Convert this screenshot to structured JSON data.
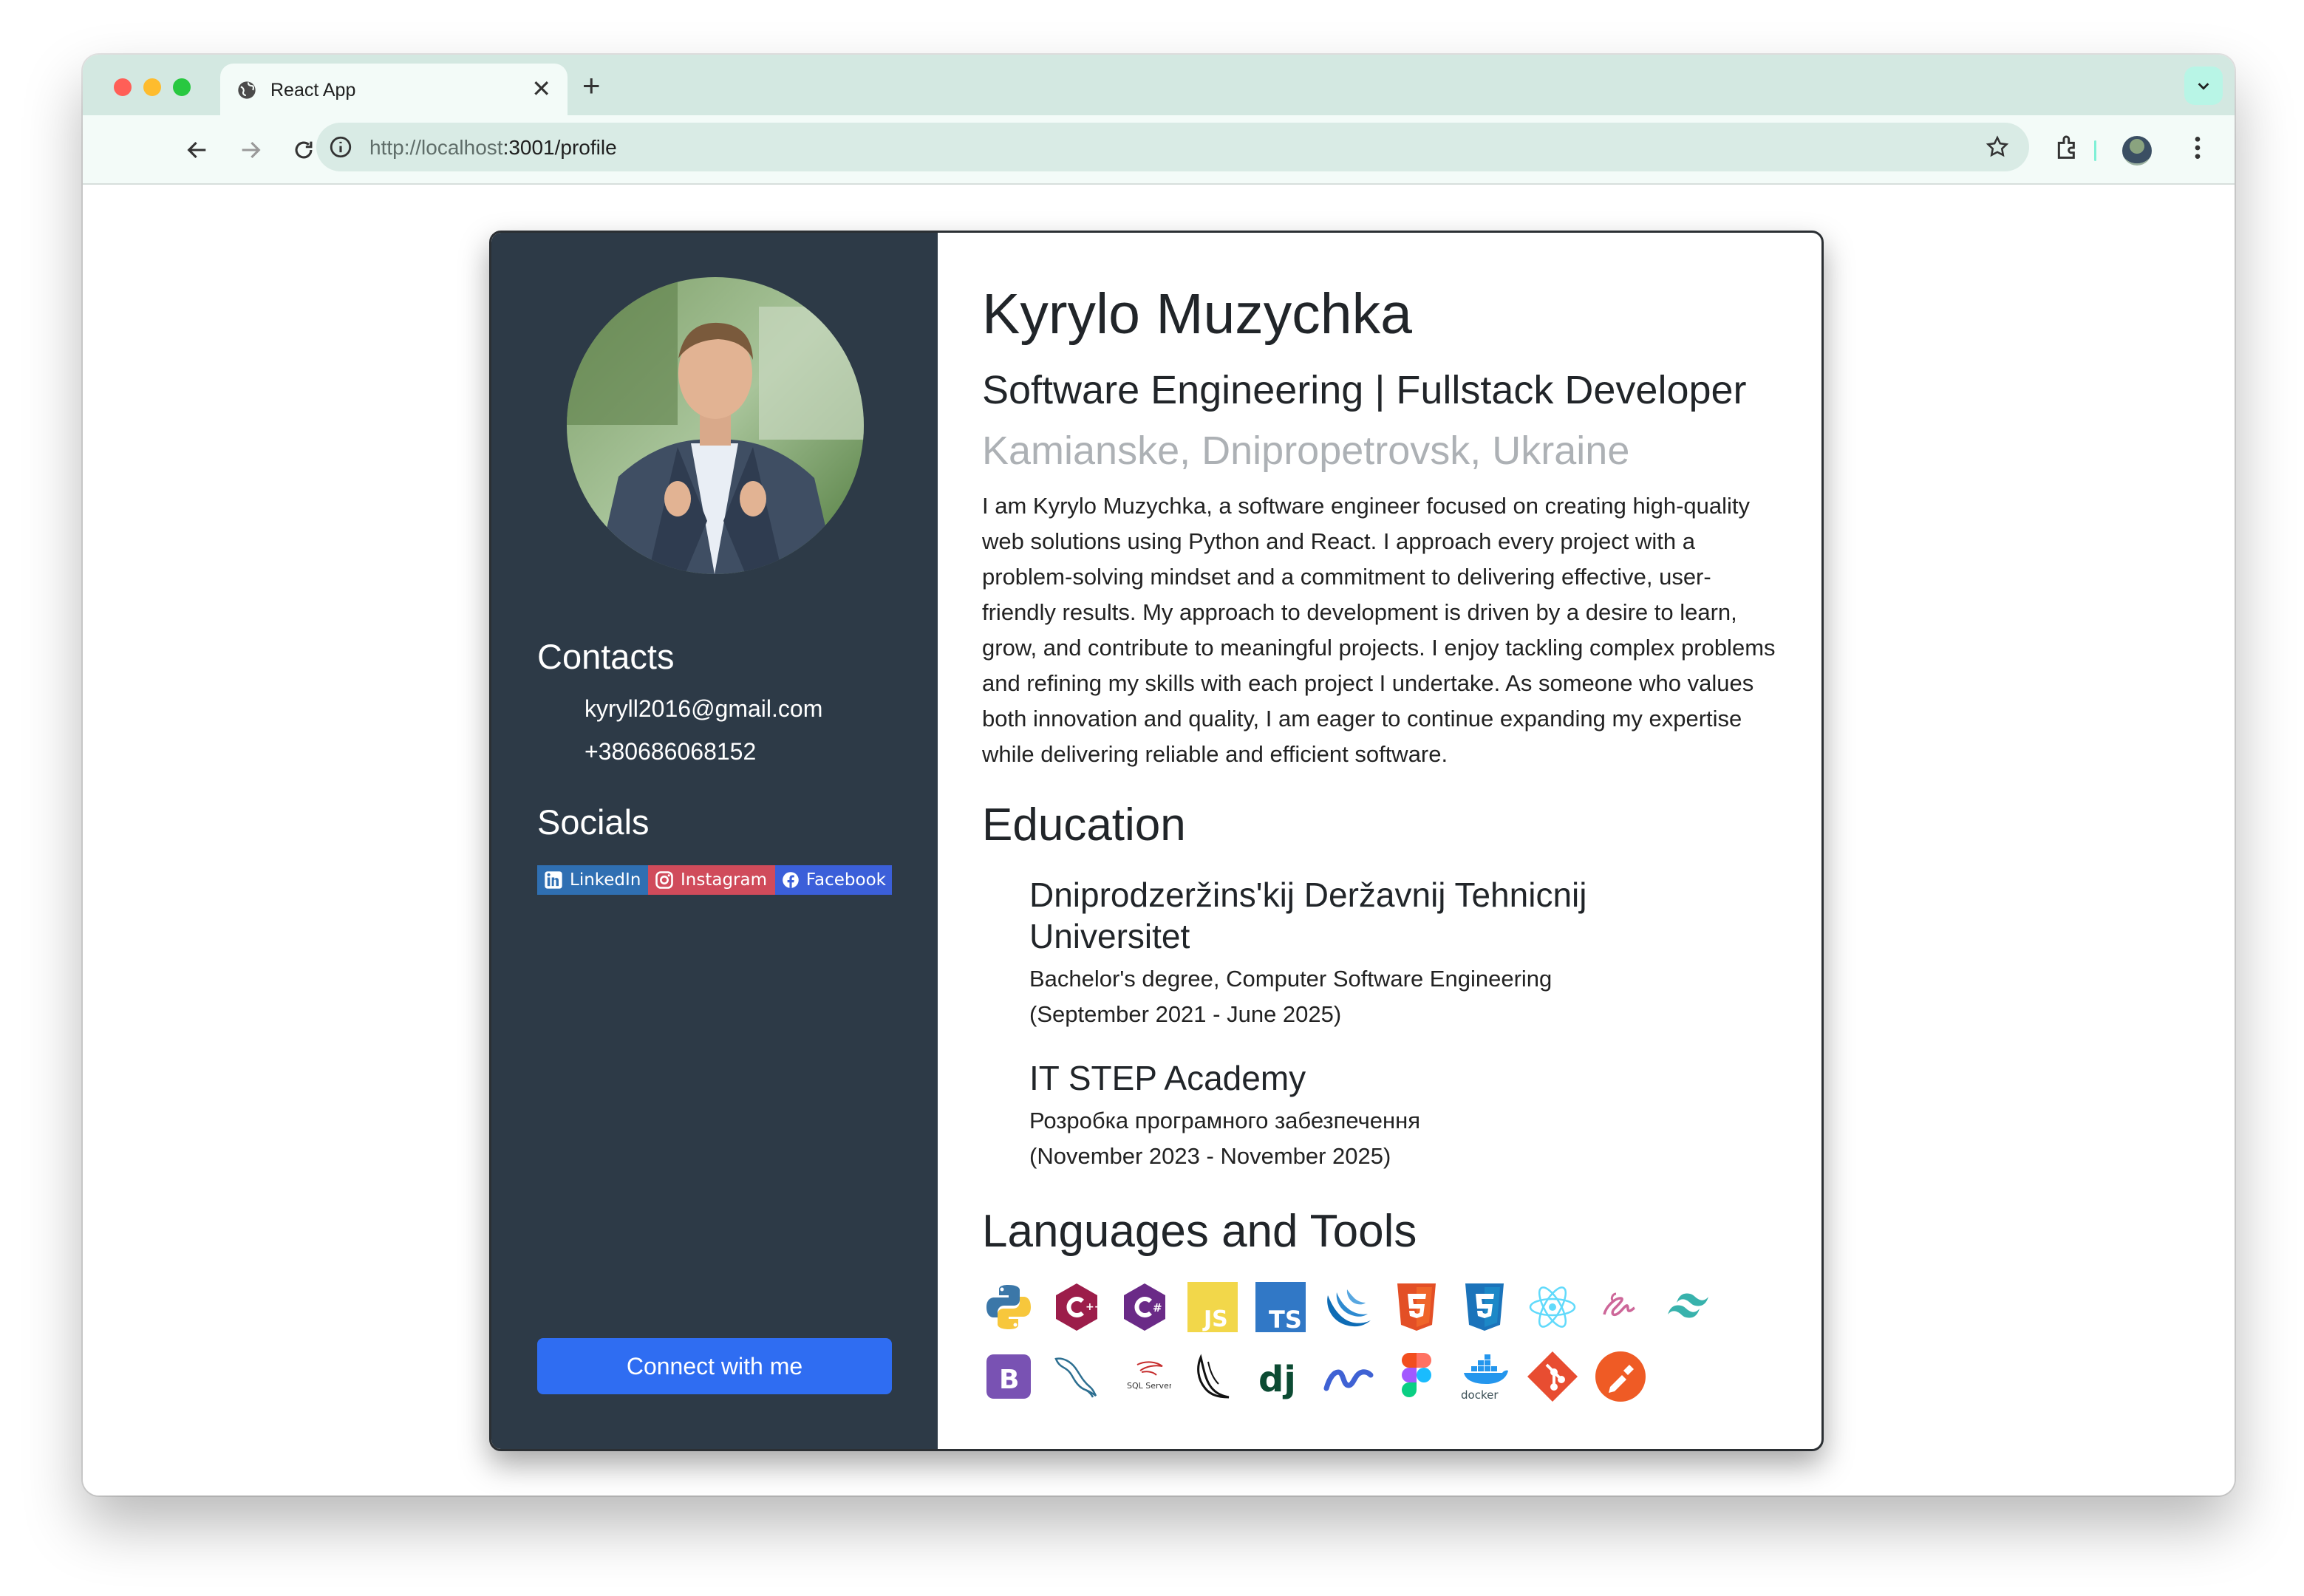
{
  "browser": {
    "tab_title": "React App",
    "url_host": "http://localhost",
    "url_rest": ":3001/profile"
  },
  "profile": {
    "name": "Kyrylo Muzychka",
    "role": "Software Engineering | Fullstack Developer",
    "location": "Kamianske, Dnipropetrovsk, Ukraine",
    "bio": "I am Kyrylo Muzychka, a software engineer focused on creating high-quality web solutions using Python and React. I approach every project with a problem-solving mindset and a commitment to delivering effective, user-friendly results. My approach to development is driven by a desire to learn, grow, and contribute to meaningful projects. I enjoy tackling complex problems and refining my skills with each project I undertake. As someone who values both innovation and quality, I am eager to continue expanding my expertise while delivering reliable and efficient software."
  },
  "sidebar": {
    "contacts_heading": "Contacts",
    "email": "kyryll2016@gmail.com",
    "phone": "+380686068152",
    "socials_heading": "Socials",
    "socials": [
      {
        "label": "LinkedIn",
        "color": "#2f6fb2"
      },
      {
        "label": "Instagram",
        "color": "#d04b5b"
      },
      {
        "label": "Facebook",
        "color": "#3b5fd9"
      }
    ],
    "connect_label": "Connect with me"
  },
  "education": {
    "heading": "Education",
    "items": [
      {
        "school": "Dniprodzeržins'kij Deržavnij Tehnicnij Universitet",
        "degree": "Bachelor's degree, Computer Software Engineering",
        "dates": "(September 2021 - June 2025)"
      },
      {
        "school": "IT STEP Academy",
        "degree": "Розробка програмного забезпечення",
        "dates": "(November 2023 - November 2025)"
      }
    ]
  },
  "tools": {
    "heading": "Languages and Tools",
    "row1": [
      "python-icon",
      "cplusplus-icon",
      "csharp-icon",
      "javascript-icon",
      "typescript-icon",
      "jquery-icon",
      "html5-icon",
      "css3-icon",
      "react-icon",
      "sass-icon",
      "tailwind-icon"
    ],
    "row2": [
      "bootstrap-icon",
      "mysql-icon",
      "sql-server-icon",
      "flask-icon",
      "django-icon",
      "nativescript-icon",
      "figma-icon",
      "docker-icon",
      "git-icon",
      "postman-icon"
    ],
    "labels": {
      "javascript": "JS",
      "typescript": "TS",
      "bootstrap": "B",
      "django": "dj",
      "docker": "docker",
      "sqlserver": "SQL Server"
    }
  },
  "colors": {
    "sidebar_bg": "#2d3a47",
    "button_bg": "#2f6df2",
    "location_gray": "#adb1b5"
  }
}
